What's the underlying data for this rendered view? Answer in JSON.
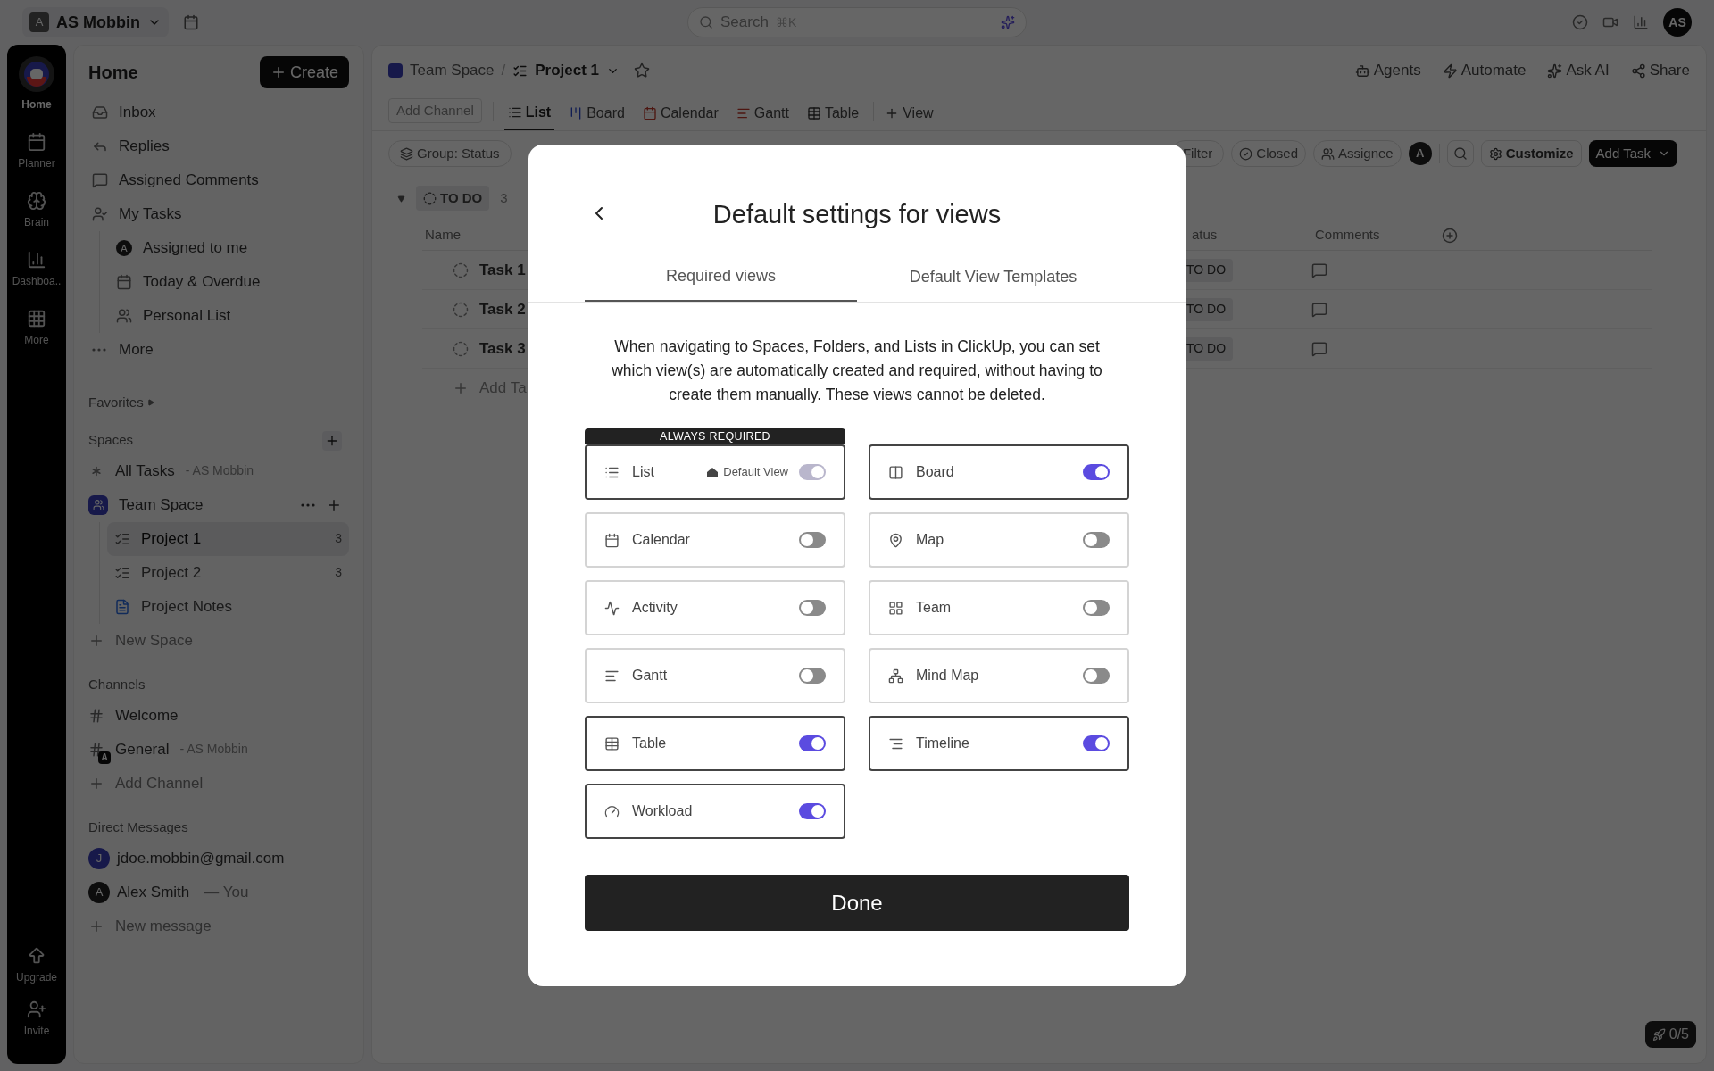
{
  "top_bar": {
    "workspace_initial": "A",
    "workspace": "AS Mobbin",
    "search": {
      "placeholder": "Search",
      "shortcut": "⌘K"
    },
    "avatar": "AS"
  },
  "rail": [
    {
      "label": "Home",
      "selected": true
    },
    {
      "label": "Planner",
      "selected": false
    },
    {
      "label": "Brain",
      "selected": false
    },
    {
      "label": "Dashboa..",
      "selected": false
    },
    {
      "label": "More",
      "selected": false
    }
  ],
  "rail_bottom": [
    "Upgrade",
    "Invite"
  ],
  "sidebar": {
    "title": "Home",
    "create_button": "Create",
    "nav": [
      {
        "label": "Inbox"
      },
      {
        "label": "Replies"
      },
      {
        "label": "Assigned Comments"
      },
      {
        "label": "My Tasks",
        "children": [
          {
            "label": "Assigned to me",
            "avatar": "A"
          },
          {
            "label": "Today & Overdue"
          },
          {
            "label": "Personal List"
          }
        ]
      },
      {
        "label": "More"
      }
    ],
    "favorites": "Favorites",
    "spaces": {
      "title": "Spaces",
      "items": [
        {
          "label": "All Tasks",
          "suffix": "- AS Mobbin"
        },
        {
          "label": "Team Space",
          "children": [
            {
              "label": "Project 1",
              "count": "3",
              "selected": true
            },
            {
              "label": "Project 2",
              "count": "3",
              "selected": false
            },
            {
              "label": "Project Notes",
              "selected": false
            }
          ]
        }
      ],
      "new_item": "New Space"
    },
    "channels": {
      "title": "Channels",
      "items": [
        {
          "label": "Welcome"
        },
        {
          "label": "General",
          "suffix": "- AS Mobbin",
          "badge": "A"
        }
      ],
      "new_item": "Add Channel"
    },
    "direct_messages": {
      "title": "Direct Messages",
      "items": [
        {
          "label": "jdoe.mobbin@gmail.com",
          "avatar": "J"
        },
        {
          "label": "Alex Smith",
          "suffix": "— You",
          "avatar": "A"
        }
      ],
      "new_item": "New message"
    }
  },
  "main": {
    "breadcrumb": [
      "Team Space",
      "Project 1"
    ],
    "breadcrumb_separator": "/",
    "actions": [
      "Agents",
      "Automate",
      "Ask AI",
      "Share"
    ],
    "add_channel": "Add Channel",
    "view_tabs": [
      {
        "label": "List",
        "selected": true
      },
      {
        "label": "Board",
        "selected": false
      },
      {
        "label": "Calendar",
        "selected": false
      },
      {
        "label": "Gantt",
        "selected": false
      },
      {
        "label": "Table",
        "selected": false
      }
    ],
    "add_view": "View",
    "toolbar": {
      "group": "Group: Status",
      "filter": "Filter",
      "closed": "Closed",
      "assignee": "Assignee",
      "avatar": "A",
      "customize": "Customize",
      "add_task": "Add Task"
    },
    "group": {
      "status": "TO DO",
      "count": "3"
    },
    "columns": [
      "Name",
      "atus",
      "Comments"
    ],
    "rows": [
      {
        "name": "Task 1",
        "status": "TO DO"
      },
      {
        "name": "Task 2",
        "status": "TO DO"
      },
      {
        "name": "Task 3",
        "status": "TO DO"
      }
    ],
    "add_task": "Add Ta",
    "badge": "0/5"
  },
  "modal": {
    "title": "Default settings for views",
    "tabs": [
      {
        "label": "Required views",
        "selected": true
      },
      {
        "label": "Default View Templates",
        "selected": false
      }
    ],
    "description": "When navigating to Spaces, Folders, and Lists in ClickUp, you can set which view(s) are automatically created and required, without having to create them manually. These views cannot be deleted.",
    "views": [
      {
        "label": "List",
        "on": true,
        "disabled": true,
        "banner": "ALWAYS REQUIRED",
        "badge": "Default View"
      },
      {
        "label": "Board",
        "on": true,
        "disabled": false
      },
      {
        "label": "Calendar",
        "on": false,
        "disabled": false
      },
      {
        "label": "Map",
        "on": false,
        "disabled": false
      },
      {
        "label": "Activity",
        "on": false,
        "disabled": false
      },
      {
        "label": "Team",
        "on": false,
        "disabled": false
      },
      {
        "label": "Gantt",
        "on": false,
        "disabled": false
      },
      {
        "label": "Mind Map",
        "on": false,
        "disabled": false
      },
      {
        "label": "Table",
        "on": true,
        "disabled": false
      },
      {
        "label": "Timeline",
        "on": true,
        "disabled": false
      },
      {
        "label": "Workload",
        "on": true,
        "disabled": false
      }
    ],
    "done": "Done"
  }
}
